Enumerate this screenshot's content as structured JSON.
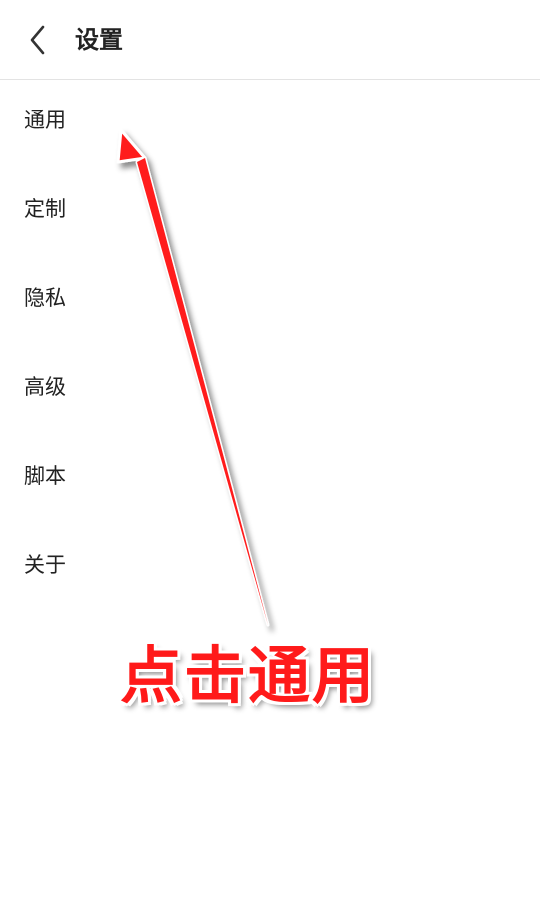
{
  "header": {
    "title": "设置",
    "back_icon": "chevron-left-icon"
  },
  "menu": {
    "items": [
      {
        "label": "通用"
      },
      {
        "label": "定制"
      },
      {
        "label": "隐私"
      },
      {
        "label": "高级"
      },
      {
        "label": "脚本"
      },
      {
        "label": "关于"
      }
    ]
  },
  "annotation": {
    "text": "点击通用",
    "color": "#ff1a1a"
  }
}
